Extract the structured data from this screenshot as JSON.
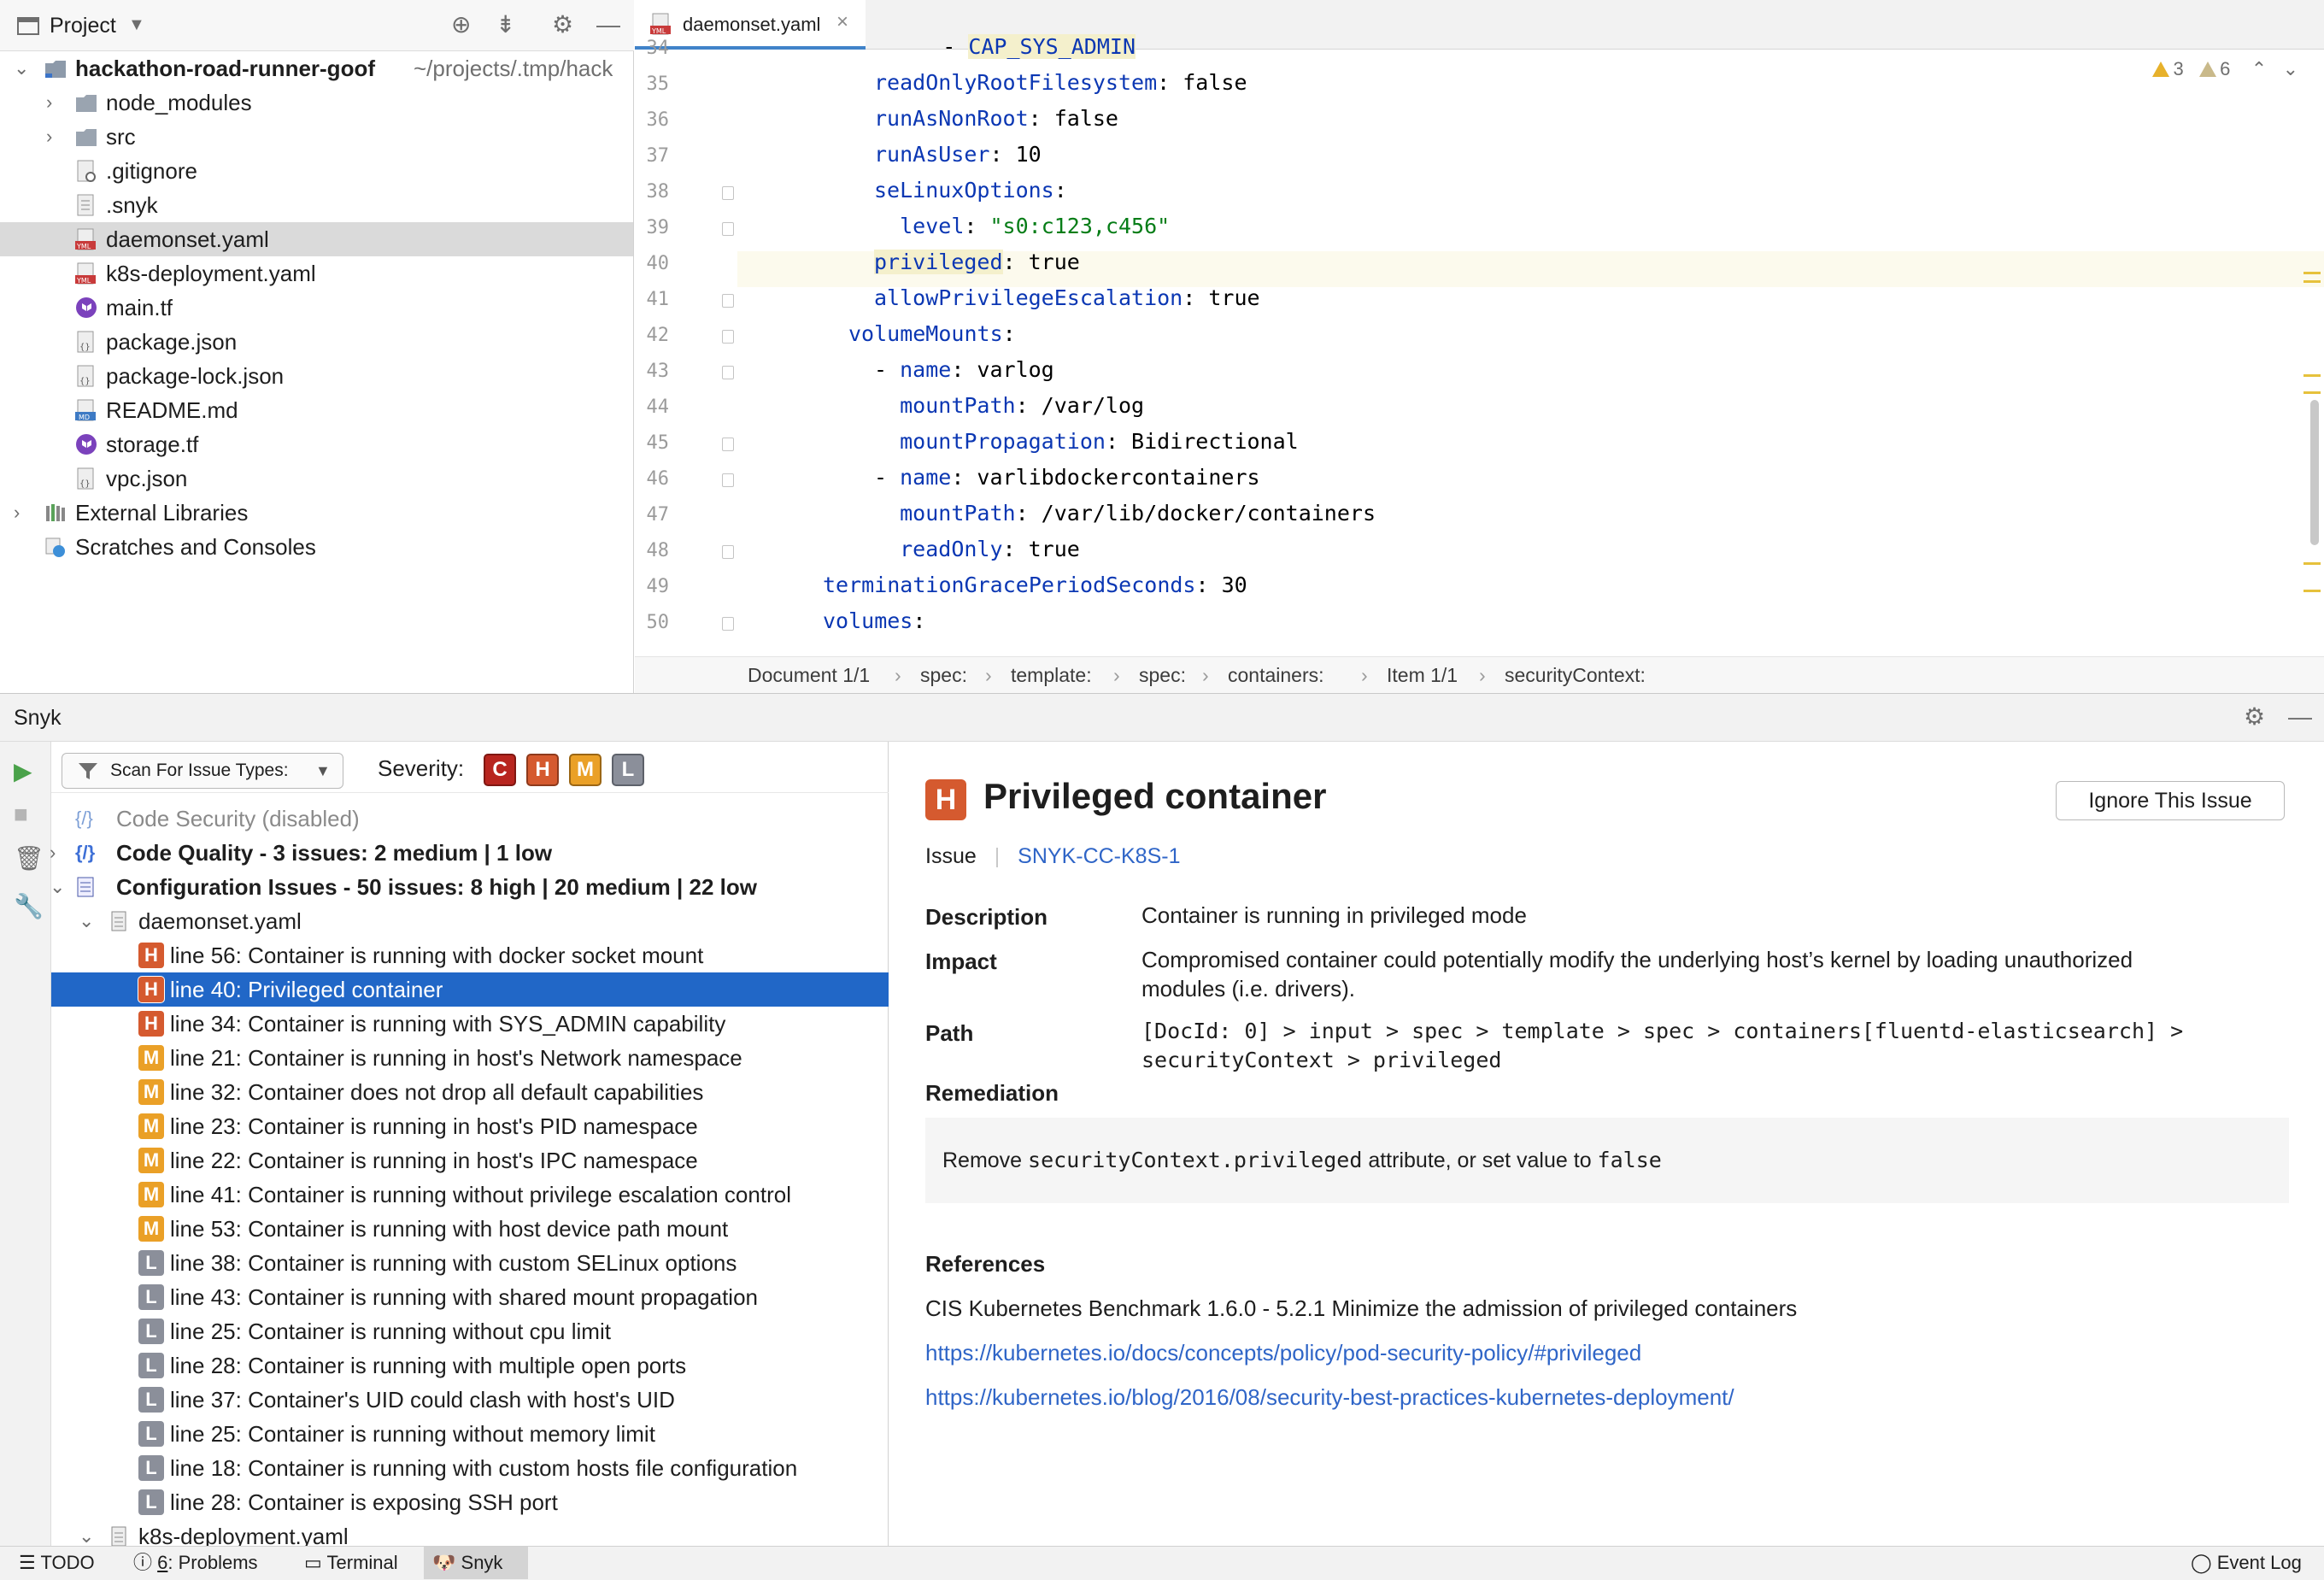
{
  "project_panel": {
    "title": "Project",
    "tree": [
      {
        "name": "hackathon-road-runner-goof",
        "path": "~/projects/.tmp/hack"
      },
      {
        "name": "node_modules"
      },
      {
        "name": "src"
      },
      {
        "name": ".gitignore"
      },
      {
        "name": ".snyk"
      },
      {
        "name": "daemonset.yaml"
      },
      {
        "name": "k8s-deployment.yaml"
      },
      {
        "name": "main.tf"
      },
      {
        "name": "package.json"
      },
      {
        "name": "package-lock.json"
      },
      {
        "name": "README.md"
      },
      {
        "name": "storage.tf"
      },
      {
        "name": "vpc.json"
      },
      {
        "name": "External Libraries"
      },
      {
        "name": "Scratches and Consoles"
      }
    ]
  },
  "editor": {
    "tab": "daemonset.yaml",
    "inspection": {
      "warnings": "3",
      "weak_warnings": "6"
    },
    "lines": [
      {
        "n": "34",
        "parts": [
          [
            "v",
            "    "
          ],
          [
            "v",
            "- "
          ],
          [
            "k",
            "CAP_SYS_ADMIN"
          ]
        ]
      },
      {
        "n": "35",
        "parts": [
          [
            "k",
            "readOnlyRootFilesystem"
          ],
          [
            "v",
            ": false"
          ]
        ]
      },
      {
        "n": "36",
        "parts": [
          [
            "k",
            "runAsNonRoot"
          ],
          [
            "v",
            ": false"
          ]
        ]
      },
      {
        "n": "37",
        "parts": [
          [
            "k",
            "runAsUser"
          ],
          [
            "v",
            ": 10"
          ]
        ]
      },
      {
        "n": "38",
        "parts": [
          [
            "k",
            "seLinuxOptions"
          ],
          [
            "v",
            ":"
          ]
        ]
      },
      {
        "n": "39",
        "parts": [
          [
            "v",
            "  "
          ],
          [
            "k",
            "level"
          ],
          [
            "v",
            ": "
          ],
          [
            "s",
            "\"s0:c123,c456\""
          ]
        ]
      },
      {
        "n": "40",
        "parts": [
          [
            "k",
            "privileged"
          ],
          [
            "v",
            ": true"
          ]
        ]
      },
      {
        "n": "41",
        "parts": [
          [
            "k",
            "allowPrivilegeEscalation"
          ],
          [
            "v",
            ": true"
          ]
        ]
      },
      {
        "n": "42",
        "parts": [
          [
            "k",
            "volumeMounts"
          ],
          [
            "v",
            ":"
          ]
        ]
      },
      {
        "n": "43",
        "parts": [
          [
            "v",
            "- "
          ],
          [
            "k",
            "name"
          ],
          [
            "v",
            ": varlog"
          ]
        ]
      },
      {
        "n": "44",
        "parts": [
          [
            "v",
            "  "
          ],
          [
            "k",
            "mountPath"
          ],
          [
            "v",
            ": /var/log"
          ]
        ]
      },
      {
        "n": "45",
        "parts": [
          [
            "v",
            "  "
          ],
          [
            "k",
            "mountPropagation"
          ],
          [
            "v",
            ": Bidirectional"
          ]
        ]
      },
      {
        "n": "46",
        "parts": [
          [
            "v",
            "- "
          ],
          [
            "k",
            "name"
          ],
          [
            "v",
            ": varlibdockercontainers"
          ]
        ]
      },
      {
        "n": "47",
        "parts": [
          [
            "v",
            "  "
          ],
          [
            "k",
            "mountPath"
          ],
          [
            "v",
            ": /var/lib/docker/containers"
          ]
        ]
      },
      {
        "n": "48",
        "parts": [
          [
            "v",
            "  "
          ],
          [
            "k",
            "readOnly"
          ],
          [
            "v",
            ": true"
          ]
        ]
      },
      {
        "n": "49",
        "parts": [
          [
            "k",
            "terminationGracePeriodSeconds"
          ],
          [
            "v",
            ": 30"
          ]
        ]
      },
      {
        "n": "50",
        "parts": [
          [
            "k",
            "volumes"
          ],
          [
            "v",
            ":"
          ]
        ]
      }
    ],
    "breadcrumb": [
      "Document 1/1",
      "spec:",
      "template:",
      "spec:",
      "containers:",
      "Item 1/1",
      "securityContext:"
    ]
  },
  "snyk": {
    "title": "Snyk",
    "scan_label": "Scan For Issue Types:",
    "severity_label": "Severity:",
    "severity_filters": [
      "C",
      "H",
      "M",
      "L"
    ],
    "code_security": "Code Security (disabled)",
    "code_quality": "Code Quality - 3 issues: 2 medium | 1 low",
    "config_issues": "Configuration Issues - 50 issues: 8 high | 20 medium | 22 low",
    "file1": "daemonset.yaml",
    "file2": "k8s-deployment.yaml",
    "issues": [
      {
        "sev": "H",
        "text": "line 56: Container is running with docker socket mount"
      },
      {
        "sev": "H",
        "text": "line 40: Privileged container"
      },
      {
        "sev": "H",
        "text": "line 34: Container is running with SYS_ADMIN capability"
      },
      {
        "sev": "M",
        "text": "line 21: Container is running in host's Network namespace"
      },
      {
        "sev": "M",
        "text": "line 32: Container does not drop all default capabilities"
      },
      {
        "sev": "M",
        "text": "line 23: Container is running in host's PID namespace"
      },
      {
        "sev": "M",
        "text": "line 22: Container is running in host's IPC namespace"
      },
      {
        "sev": "M",
        "text": "line 41: Container is running without privilege escalation control"
      },
      {
        "sev": "M",
        "text": "line 53: Container is running with host device path mount"
      },
      {
        "sev": "L",
        "text": "line 38: Container is running with custom SELinux options"
      },
      {
        "sev": "L",
        "text": "line 43: Container is running with shared mount propagation"
      },
      {
        "sev": "L",
        "text": "line 25: Container is running without cpu limit"
      },
      {
        "sev": "L",
        "text": "line 28: Container is running with multiple open ports"
      },
      {
        "sev": "L",
        "text": "line 37: Container's UID could clash with host's UID"
      },
      {
        "sev": "L",
        "text": "line 25: Container is running without memory limit"
      },
      {
        "sev": "L",
        "text": "line 18: Container is running with custom hosts file configuration"
      },
      {
        "sev": "L",
        "text": "line 28: Container is exposing SSH port"
      }
    ],
    "details": {
      "badge": "H",
      "title": "Privileged container",
      "issue_label": "Issue",
      "issue_id": "SNYK-CC-K8S-1",
      "ignore_button": "Ignore This Issue",
      "description_label": "Description",
      "description": "Container is running in privileged mode",
      "impact_label": "Impact",
      "impact_line1": "Compromised container could potentially modify the underlying host’s kernel by loading unauthorized",
      "impact_line2": "modules (i.e. drivers).",
      "path_label": "Path",
      "path_line1": "[DocId: 0] > input > spec > template > spec > containers[fluentd-elasticsearch] >",
      "path_line2": "securityContext > privileged",
      "remediation_label": "Remediation",
      "remediation_pre": "Remove ",
      "remediation_code1": "securityContext.privileged",
      "remediation_mid": " attribute, or set value to ",
      "remediation_code2": "false",
      "references_label": "References",
      "reference_text": "CIS Kubernetes Benchmark 1.6.0 - 5.2.1 Minimize the admission of privileged containers",
      "link1": "https://kubernetes.io/docs/concepts/policy/pod-security-policy/#privileged",
      "link2": "https://kubernetes.io/blog/2016/08/security-best-practices-kubernetes-deployment/"
    }
  },
  "statusbar": {
    "todo": "TODO",
    "problems_num": "6",
    "problems": ": Problems",
    "terminal": "Terminal",
    "snyk": "Snyk",
    "event_log": "Event Log"
  },
  "colors": {
    "high": "#d55a2f",
    "medium": "#eaa027",
    "low": "#8b8f9a",
    "critical": "#b8251f",
    "selection": "#2167c7",
    "link": "#2f65c7"
  }
}
